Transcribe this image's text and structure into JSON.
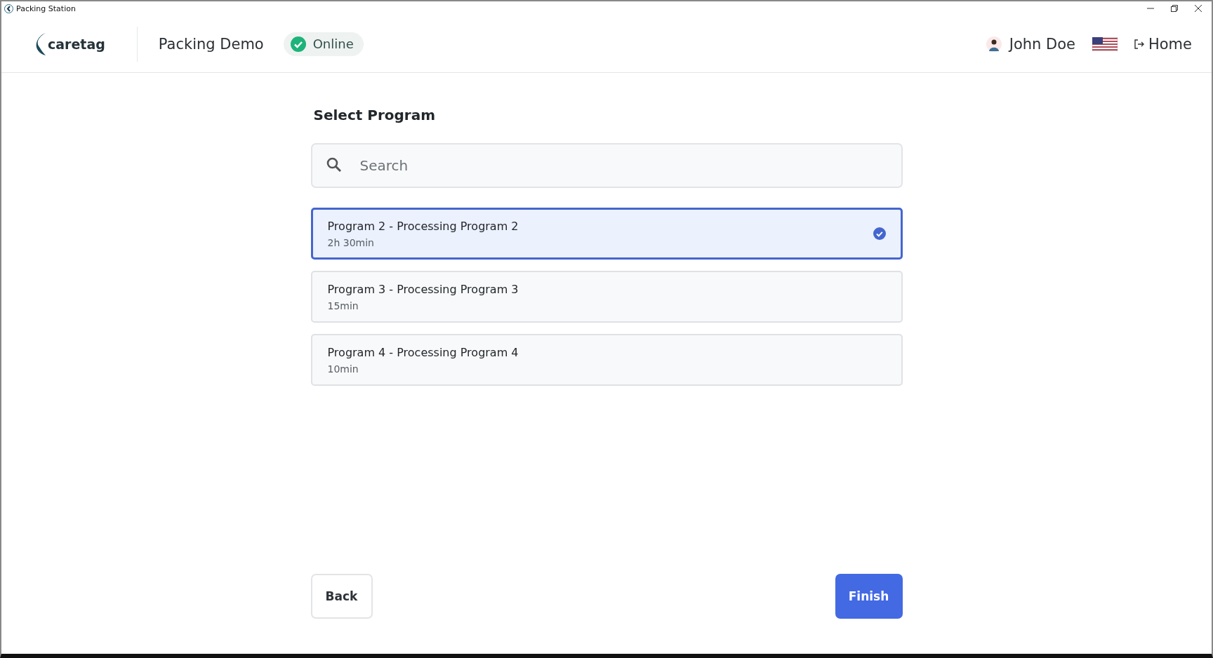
{
  "window": {
    "title": "Packing Station"
  },
  "header": {
    "logo": "caretag",
    "station": "Packing Demo",
    "status": {
      "label": "Online",
      "online": true
    },
    "user": "John Doe",
    "home": "Home"
  },
  "heading": "Select Program",
  "search": {
    "placeholder": "Search"
  },
  "programs": [
    {
      "name": "Program 2 - Processing Program 2",
      "duration": "2h 30min",
      "selected": true
    },
    {
      "name": "Program 3 - Processing Program 3",
      "duration": "15min",
      "selected": false
    },
    {
      "name": "Program 4 - Processing Program 4",
      "duration": "10min",
      "selected": false
    }
  ],
  "buttons": {
    "back": "Back",
    "finish": "Finish"
  }
}
